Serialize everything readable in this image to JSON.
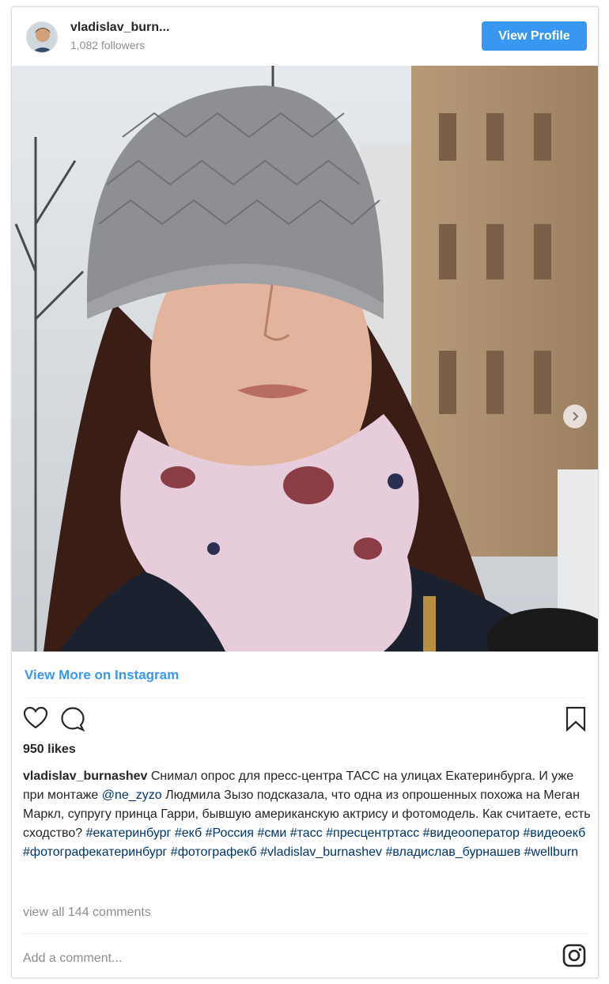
{
  "header": {
    "username": "vladislav_burn...",
    "followers": "1,082 followers",
    "view_profile": "View Profile"
  },
  "post": {
    "photo_icon": "carousel-next-icon",
    "view_more": "View More on Instagram",
    "likes": "950 likes",
    "caption": {
      "username": "vladislav_burnashev",
      "text_1": " Снимал опрос для пресс-центра ТАСС на улицах Екатеринбурга. И уже при монтаже ",
      "mention": "@ne_zyzo",
      "text_2": " Людмила Зызо подсказала, что одна из опрошенных похожа на Меган Маркл, супругу принца Гарри, бывшую американскую актрису и фотомодель. Как считаете, есть сходство? ",
      "hashtags": [
        "#екатеринбург",
        "#екб",
        "#Россия",
        "#сми",
        "#тасс",
        "#пресцентртасс",
        "#видеооператор",
        "#видеоекб",
        "#фотографекатеринбург",
        "#фотографекб",
        "#vladislav_burnashev",
        "#владислав_бурнашев",
        "#wellburn"
      ]
    },
    "view_all_comments": "view all 144 comments",
    "comment_placeholder": "Add a comment..."
  },
  "icons": [
    "avatar",
    "heart-icon",
    "comment-icon",
    "bookmark-icon",
    "instagram-icon",
    "chevron-right-icon"
  ],
  "colors": {
    "accent": "#3897f0",
    "hashtag": "#003569",
    "muted": "#8e8e8e"
  }
}
